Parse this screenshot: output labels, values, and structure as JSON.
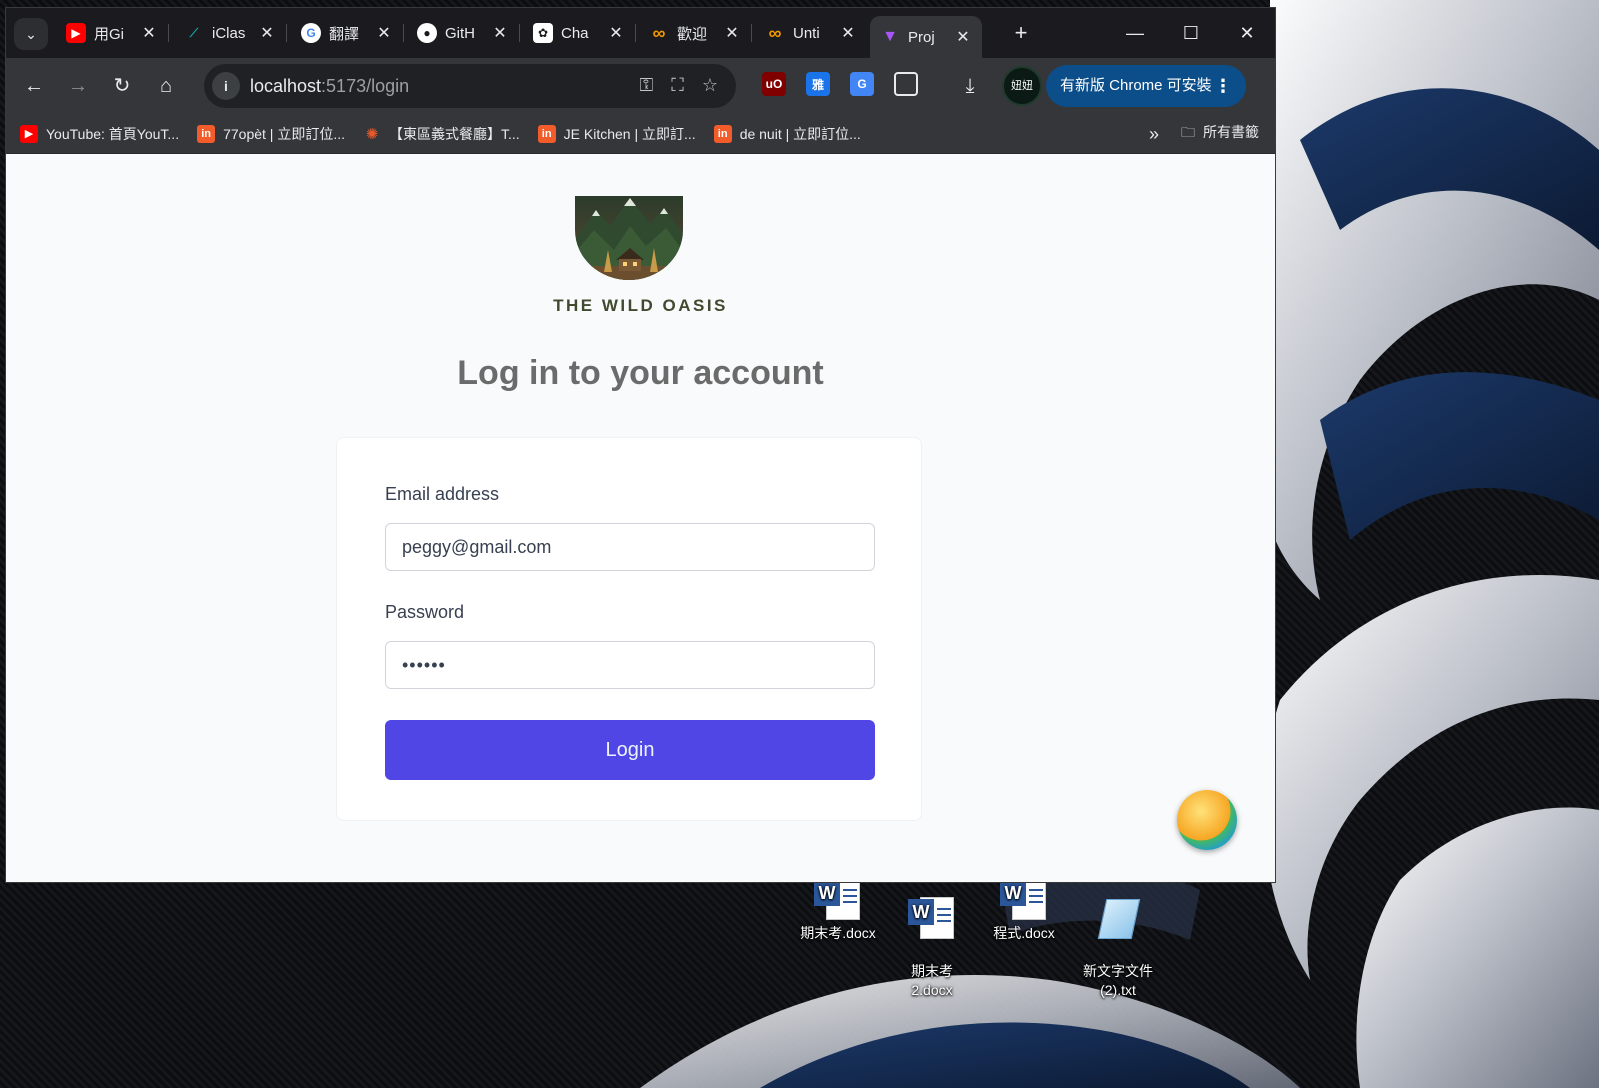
{
  "browser": {
    "tabs": [
      {
        "title": "用Gi",
        "favicon": "youtube-icon",
        "color": "#ff0000"
      },
      {
        "title": "iClas",
        "favicon": "iclass-icon",
        "color": "#16a3a3"
      },
      {
        "title": "翻譯",
        "favicon": "google-icon",
        "color": "#ffffff"
      },
      {
        "title": "GitH",
        "favicon": "github-icon",
        "color": "#ffffff"
      },
      {
        "title": "Cha",
        "favicon": "chatgpt-icon",
        "color": "#ffffff"
      },
      {
        "title": "歡迎",
        "favicon": "infinity-icon",
        "color": "#f29900"
      },
      {
        "title": "Unti",
        "favicon": "infinity-icon",
        "color": "#f29900"
      },
      {
        "title": "Proj",
        "favicon": "vite-icon",
        "color": "#a855f7"
      }
    ],
    "tab_close": "✕",
    "new_tab": "+",
    "address": {
      "host": "localhost",
      "path": ":5173/login"
    },
    "profile_label": "妞妞",
    "update_button": "有新版 Chrome 可安裝",
    "extensions": [
      {
        "label": "uO",
        "color": "#800000"
      },
      {
        "label": "雅",
        "color": "#1a73e8"
      },
      {
        "label": "G",
        "color": "#4285f4"
      }
    ],
    "bookmarks": [
      {
        "label": "YouTube: 首頁YouT...",
        "color": "#ff0000",
        "icon": "youtube-icon"
      },
      {
        "label": "77opèt | 立即訂位...",
        "color": "#f25c2b",
        "icon": "inline-icon"
      },
      {
        "label": "【東區義式餐廳】T...",
        "color": "#e85a2a",
        "icon": "flower-icon"
      },
      {
        "label": "JE Kitchen | 立即訂...",
        "color": "#f25c2b",
        "icon": "inline-icon"
      },
      {
        "label": "de nuit | 立即訂位...",
        "color": "#f25c2b",
        "icon": "inline-icon"
      }
    ],
    "bookmarks_more": "»",
    "all_bookmarks": "所有書籤"
  },
  "page": {
    "brand": "THE WILD OASIS",
    "heading": "Log in to your account",
    "email_label": "Email address",
    "email_value": "peggy@gmail.com",
    "password_label": "Password",
    "password_value": "••••••",
    "login_button": "Login",
    "accent": "#4f46e5"
  },
  "desktop": {
    "icons": [
      {
        "label": "期末考.docx",
        "type": "word"
      },
      {
        "label": "期末考\n2.docx",
        "type": "word"
      },
      {
        "label": "程式.docx",
        "type": "word"
      },
      {
        "label": "新文字文件\n(2).txt",
        "type": "text"
      }
    ]
  }
}
